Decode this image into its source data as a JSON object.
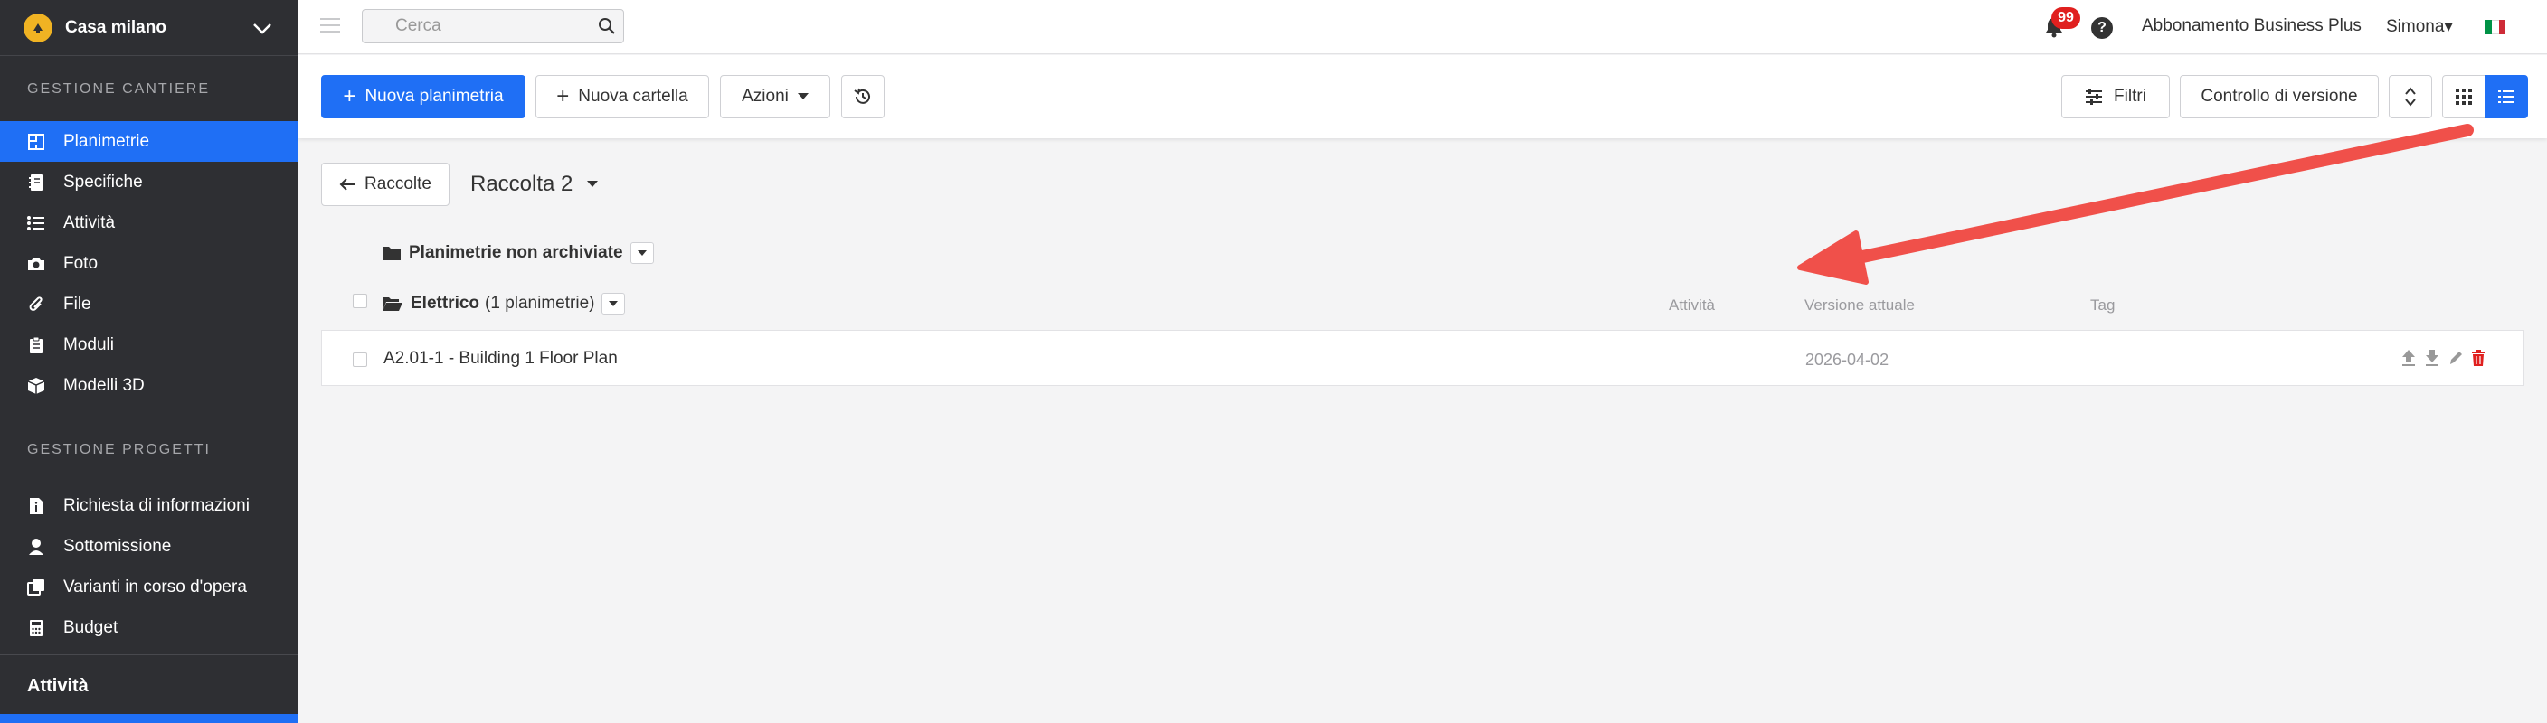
{
  "sidebar": {
    "project_name": "Casa milano",
    "section1_title": "GESTIONE CANTIERE",
    "section1_items": [
      {
        "label": "Planimetrie",
        "icon": "floorplan-icon",
        "active": true
      },
      {
        "label": "Specifiche",
        "icon": "notebook-icon"
      },
      {
        "label": "Attività",
        "icon": "list-icon"
      },
      {
        "label": "Foto",
        "icon": "camera-icon"
      },
      {
        "label": "File",
        "icon": "paperclip-icon"
      },
      {
        "label": "Moduli",
        "icon": "clipboard-icon"
      },
      {
        "label": "Modelli 3D",
        "icon": "cube-icon"
      }
    ],
    "section2_title": "GESTIONE PROGETTI",
    "section2_items": [
      {
        "label": "Richiesta di informazioni",
        "icon": "info-doc-icon"
      },
      {
        "label": "Sottomissione",
        "icon": "person-icon"
      },
      {
        "label": "Varianti in corso d'opera",
        "icon": "copy-icon"
      },
      {
        "label": "Budget",
        "icon": "calculator-icon"
      }
    ],
    "section3_title": "Attività"
  },
  "topbar": {
    "search_placeholder": "Cerca",
    "notifications_count": "99",
    "help_glyph": "?",
    "subscription": "Abbonamento Business Plus",
    "user": "Simona",
    "user_caret": "▾",
    "flag_colors": [
      "#009246",
      "#ffffff",
      "#ce2b37"
    ]
  },
  "toolbar": {
    "new_plan": "Nuova planimetria",
    "new_folder": "Nuova cartella",
    "actions": "Azioni",
    "filters": "Filtri",
    "version_control": "Controllo di versione"
  },
  "content": {
    "back_label": "Raccolte",
    "collection_title": "Raccolta 2",
    "unarchived_folder": "Planimetrie non archiviate",
    "folder_name": "Elettrico",
    "folder_count": "(1 planimetrie)",
    "columns": {
      "activities": "Attività",
      "current_version": "Versione attuale",
      "tag": "Tag"
    },
    "rows": [
      {
        "name": "A2.01-1 - Building 1 Floor Plan",
        "version": "2026-04-02"
      }
    ]
  },
  "colors": {
    "accent": "#1f6ff5",
    "sidebar_bg": "#2e2f33",
    "annotation_arrow": "#f0504a",
    "delete": "#e0201f"
  }
}
